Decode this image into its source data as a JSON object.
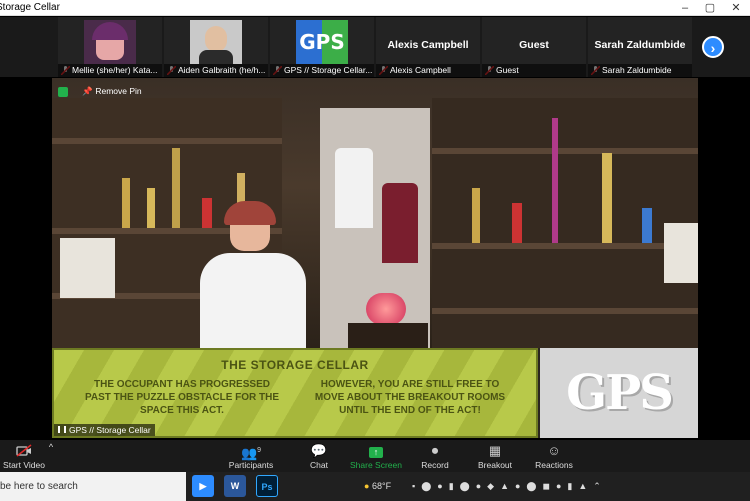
{
  "window": {
    "title": "Storage Cellar"
  },
  "gallery": {
    "participants": [
      {
        "name": "Mellie (she/her) Kata...",
        "muted": true
      },
      {
        "name": "Aiden Galbraith (he/h...",
        "muted": true
      },
      {
        "name": "GPS // Storage Cellar...",
        "muted": true
      },
      {
        "name": "Alexis Campbell",
        "display": "Alexis Campbell",
        "muted": true
      },
      {
        "name": "Guest",
        "display": "Guest",
        "muted": true
      },
      {
        "name": "Sarah Zaldumbide",
        "display": "Sarah Zaldumbide",
        "muted": true
      }
    ]
  },
  "stage": {
    "remove_pin": "Remove Pin",
    "name_label": "GPS // Storage Cellar",
    "banner_title": "THE STORAGE CELLAR",
    "banner_left": "THE OCCUPANT HAS PROGRESSED PAST THE PUZZLE OBSTACLE FOR THE SPACE THIS ACT.",
    "banner_right": "HOWEVER, YOU ARE STILL FREE TO MOVE ABOUT THE BREAKOUT ROOMS UNTIL THE END OF THE ACT!",
    "logo_text": "GPS"
  },
  "toolbar": {
    "start_video": "Start Video",
    "participants": "Participants",
    "participant_count": "9",
    "chat": "Chat",
    "share_screen": "Share Screen",
    "record": "Record",
    "breakout_rooms": "Breakout Rooms",
    "reactions": "Reactions"
  },
  "taskbar": {
    "search_placeholder": "be here to search",
    "temperature": "68°F",
    "colors": {
      "accent": "#2d8cff",
      "share": "#22b14c"
    }
  }
}
